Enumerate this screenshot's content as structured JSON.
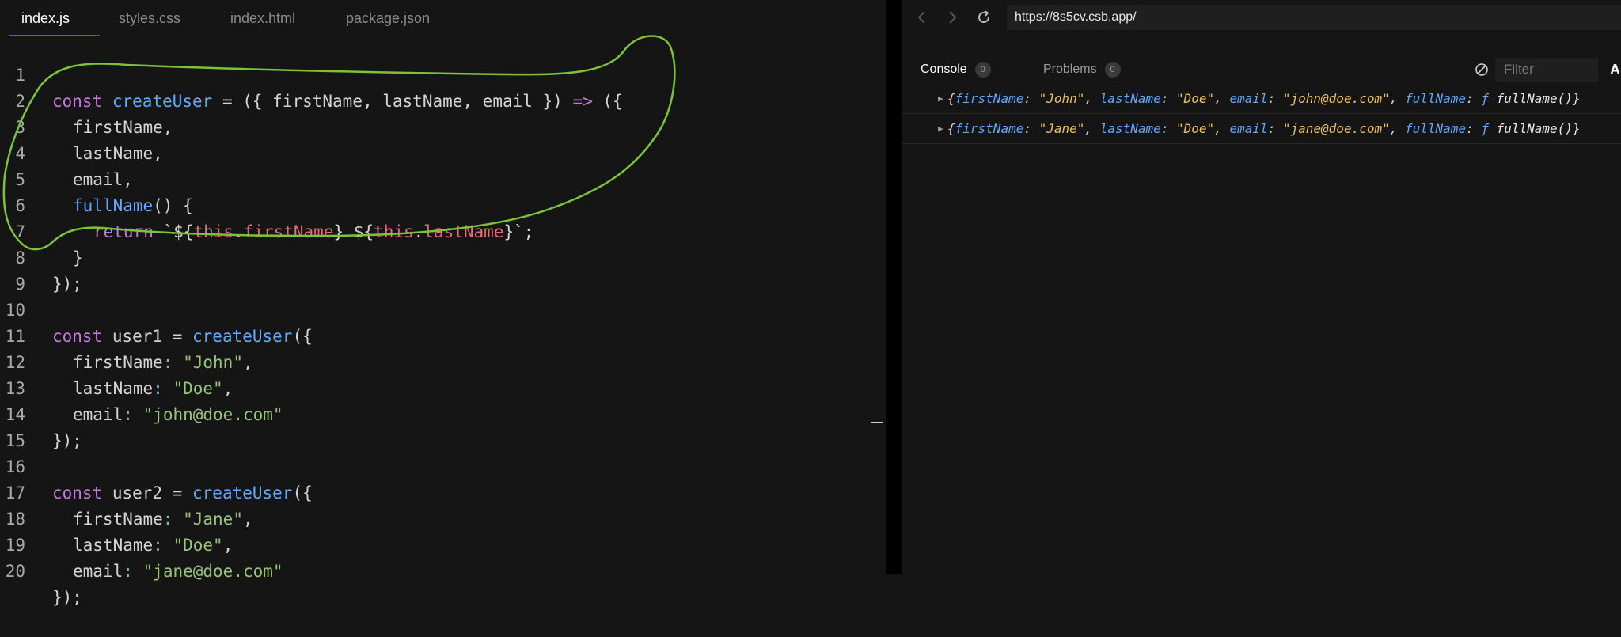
{
  "editor": {
    "tabs": [
      "index.js",
      "styles.css",
      "index.html",
      "package.json"
    ],
    "line_numbers": [
      "1",
      "2",
      "3",
      "4",
      "5",
      "6",
      "7",
      "8",
      "9",
      "10",
      "11",
      "12",
      "13",
      "14",
      "15",
      "16",
      "17",
      "18",
      "19",
      "20"
    ],
    "code": {
      "l1": {
        "kw": "const",
        "fn": "createUser",
        "rest": " = ({ firstName, lastName, email }) ",
        "arrow": "=>",
        "end": " ({"
      },
      "l2": "firstName,",
      "l3": "lastName,",
      "l4": "email,",
      "l5": {
        "fn": "fullName",
        "rest": "() {"
      },
      "l6": {
        "kw": "return",
        "p1": " `${",
        "this1": "this",
        "dot1": ".",
        "m1": "firstName",
        "p2": "} ${",
        "this2": "this",
        "dot2": ".",
        "m2": "lastName",
        "p3": "}`;"
      },
      "l7": "}",
      "l8": "});",
      "l10": {
        "kw": "const",
        "name": " user1 = ",
        "fn": "createUser",
        "end": "({"
      },
      "l11": {
        "key": "firstName",
        "colon": ":",
        "val": "\"John\"",
        "end": ","
      },
      "l12": {
        "key": "lastName",
        "colon": ":",
        "val": "\"Doe\"",
        "end": ","
      },
      "l13": {
        "key": "email",
        "colon": ":",
        "val": "\"john@doe.com\""
      },
      "l14": "});",
      "l16": {
        "kw": "const",
        "name": " user2 = ",
        "fn": "createUser",
        "end": "({"
      },
      "l17": {
        "key": "firstName",
        "colon": ":",
        "val": "\"Jane\"",
        "end": ","
      },
      "l18": {
        "key": "lastName",
        "colon": ":",
        "val": "\"Doe\"",
        "end": ","
      },
      "l19": {
        "key": "email",
        "colon": ":",
        "val": "\"jane@doe.com\""
      },
      "l20": "});"
    },
    "annotation_color": "#7cc33a"
  },
  "preview": {
    "url": "https://8s5cv.csb.app/",
    "console_tab": "Console",
    "console_count": "0",
    "problems_tab": "Problems",
    "problems_count": "0",
    "filter_placeholder": "Filter",
    "cut_label": "Al",
    "logs": [
      {
        "firstName": "\"John\"",
        "lastName": "\"Doe\"",
        "email": "\"john@doe.com\"",
        "fn_marker": "ƒ",
        "fn_name": "fullName()}"
      },
      {
        "firstName": "\"Jane\"",
        "lastName": "\"Doe\"",
        "email": "\"jane@doe.com\"",
        "fn_marker": "ƒ",
        "fn_name": "fullName()}"
      }
    ]
  }
}
